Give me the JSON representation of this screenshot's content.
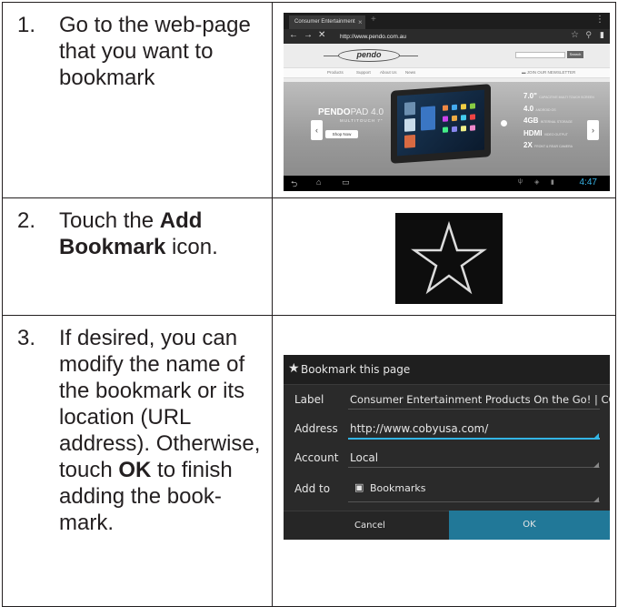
{
  "steps": [
    {
      "number": "1.",
      "text": "Go to the web-page that you want to bookmark"
    },
    {
      "number": "2.",
      "text_before": "Touch the ",
      "bold": "Add Bookmark",
      "text_after": " icon."
    },
    {
      "number": "3.",
      "text_before": "If desired, you can modify the name of the bookmark or its location (URL address). Otherwise, touch ",
      "bold": "OK",
      "text_after": " to finish adding the book-mark."
    }
  ],
  "screenshot1": {
    "tab_title": "Consumer Entertainment",
    "tab_close": "×",
    "tab_new": "+",
    "url": "http://www.pendo.com.au",
    "logo": "pendo",
    "search_button": "Search",
    "menu": [
      "Products",
      "Support",
      "About Us",
      "News"
    ],
    "newsletter": "JOIN OUR NEWSLETTER",
    "banner_brand": "PENDO",
    "banner_product": "PAD 4.0",
    "banner_sub": "MULTITOUCH 7\"",
    "shop_now": "Shop Now",
    "specs": [
      {
        "big": "7.0\"",
        "small": "CAPACITIVE MULTI TOUCH SCREEN"
      },
      {
        "big": "4.0",
        "small": "ANDROID OS"
      },
      {
        "big": "4GB",
        "small": "INTERNAL STORAGE"
      },
      {
        "big": "HDMI",
        "small": "VIDEO OUTPUT"
      },
      {
        "big": "2X",
        "small": "FRONT & REAR CAMERA"
      }
    ],
    "clock": "4:47",
    "nav_prev": "‹",
    "nav_next": "›"
  },
  "screenshot3": {
    "title": "Bookmark this page",
    "fields": [
      {
        "label": "Label",
        "value": "Consumer Entertainment Products On the Go! | COBY"
      },
      {
        "label": "Address",
        "value": "http://www.cobyusa.com/"
      },
      {
        "label": "Account",
        "value": "Local"
      },
      {
        "label": "Add to",
        "value": "Bookmarks"
      }
    ],
    "cancel": "Cancel",
    "ok": "OK"
  },
  "colors": {
    "accent_blue": "#33b5e5",
    "ok_button": "#217898",
    "border": "#231f20"
  }
}
